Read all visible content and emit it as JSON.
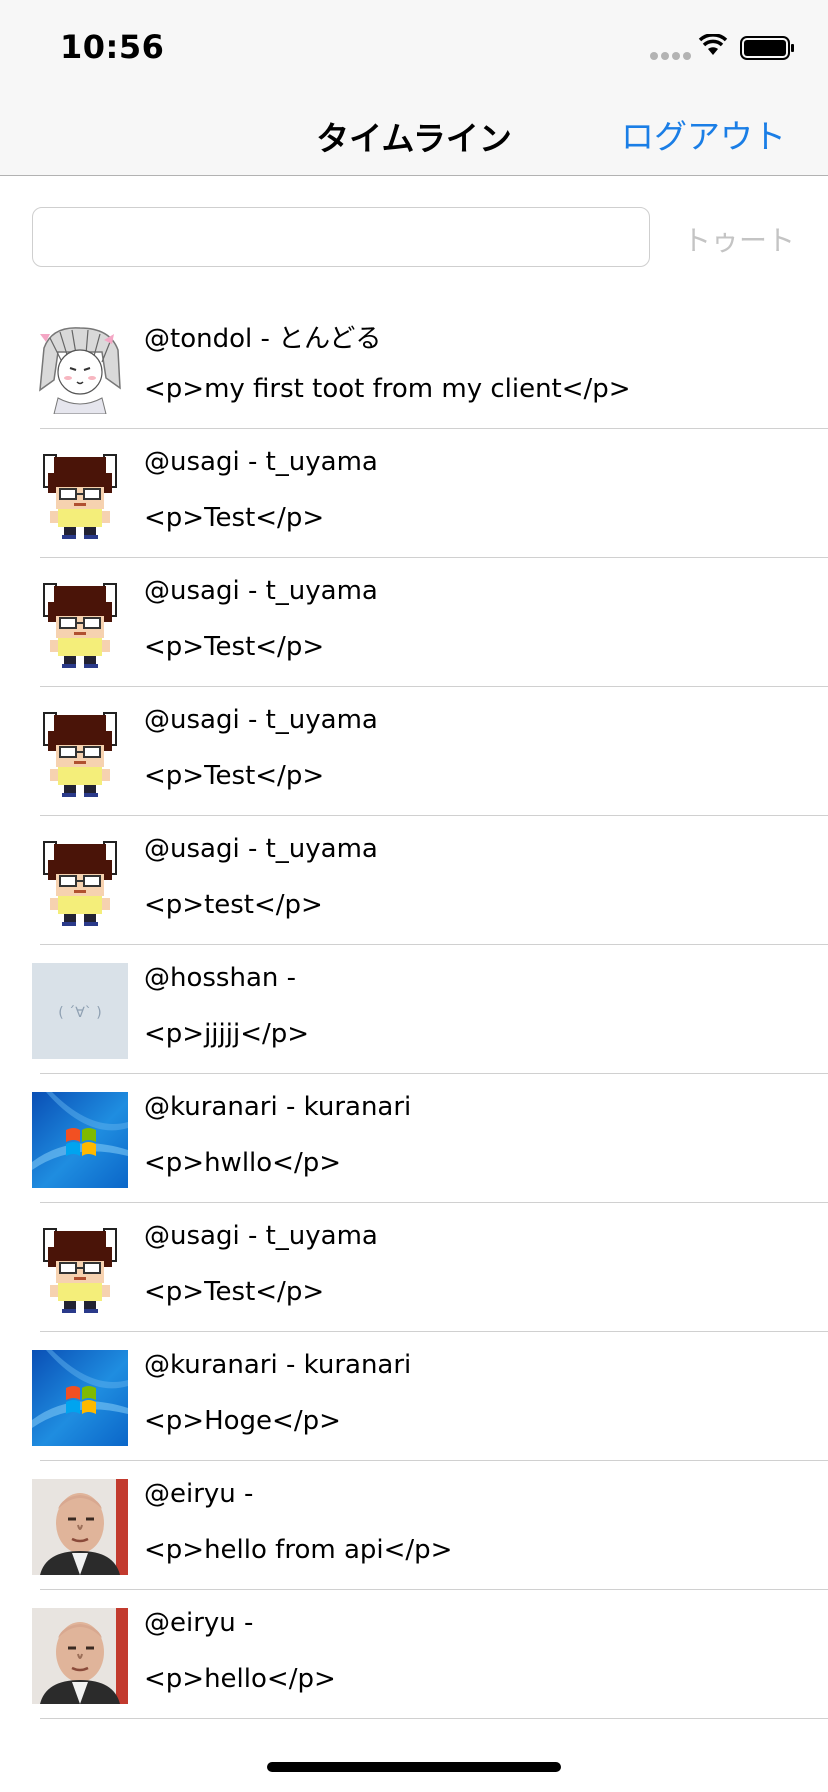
{
  "status_bar": {
    "time": "10:56"
  },
  "nav": {
    "title": "タイムライン",
    "logout_label": "ログアウト"
  },
  "compose": {
    "input_value": "",
    "input_placeholder": "",
    "toot_label": "トゥート"
  },
  "timeline": [
    {
      "name": "@tondol - とんどる",
      "text": "<p>my first toot from my client</p>",
      "avatar": "sketch-girl"
    },
    {
      "name": "@usagi - t_uyama",
      "text": "<p>Test</p>",
      "avatar": "pixel-bunny"
    },
    {
      "name": "@usagi - t_uyama",
      "text": "<p>Test</p>",
      "avatar": "pixel-bunny"
    },
    {
      "name": "@usagi - t_uyama",
      "text": "<p>Test</p>",
      "avatar": "pixel-bunny"
    },
    {
      "name": "@usagi - t_uyama",
      "text": "<p>test</p>",
      "avatar": "pixel-bunny"
    },
    {
      "name": "@hosshan - ",
      "text": "<p>jjjjj</p>",
      "avatar": "default-face"
    },
    {
      "name": "@kuranari - kuranari",
      "text": "<p>hwllo</p>",
      "avatar": "windows-logo"
    },
    {
      "name": "@usagi - t_uyama",
      "text": "<p>Test</p>",
      "avatar": "pixel-bunny"
    },
    {
      "name": "@kuranari - kuranari",
      "text": "<p>Hoge</p>",
      "avatar": "windows-logo"
    },
    {
      "name": "@eiryu - ",
      "text": "<p>hello from api</p>",
      "avatar": "photo-man"
    },
    {
      "name": "@eiryu - ",
      "text": "<p>hello</p>",
      "avatar": "photo-man"
    }
  ],
  "colors": {
    "accent": "#1a7ee6",
    "bar_background": "#f7f7f7",
    "separator": "#d0d0d0",
    "disabled_text": "#c4c4c4"
  }
}
